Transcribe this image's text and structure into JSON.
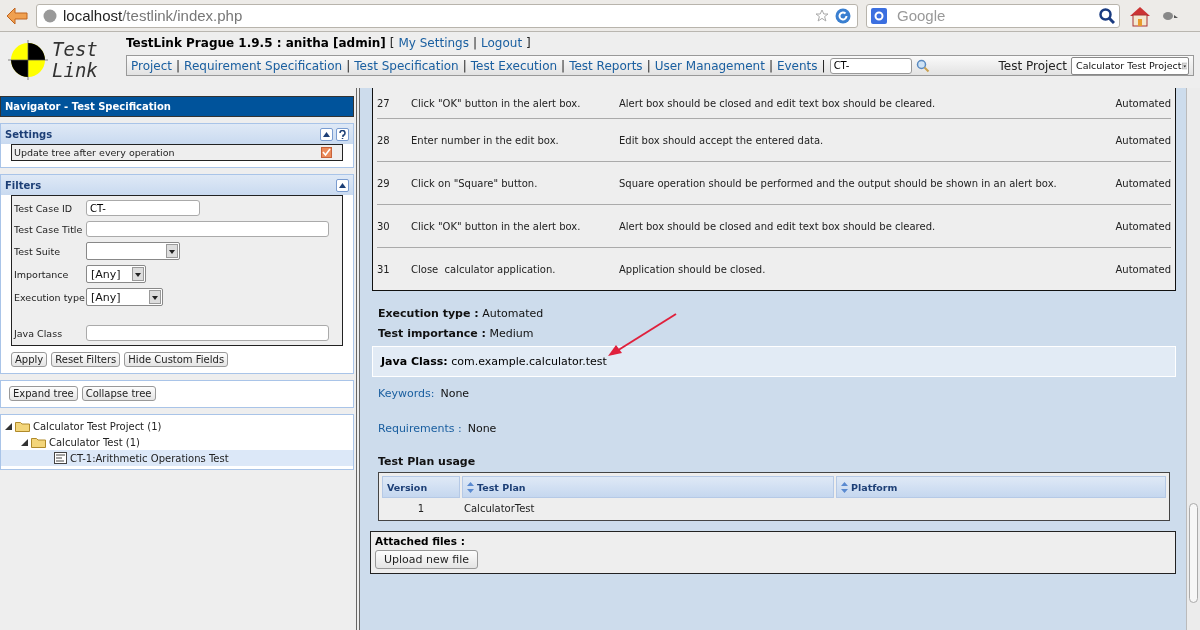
{
  "browser": {
    "url_host": "localhost",
    "url_path": "/testlink/index.php",
    "search_placeholder": "Google"
  },
  "header": {
    "logo": {
      "line_1": "Test",
      "line_2": "Link"
    },
    "title": "TestLink Prague 1.9.5 : anitha [admin]",
    "account": [
      {
        "kind": "separator",
        "text": "["
      },
      {
        "kind": "link",
        "text": "My Settings"
      },
      {
        "kind": "separator",
        "text": "|"
      },
      {
        "kind": "link",
        "text": "Logout"
      },
      {
        "kind": "separator",
        "text": "]"
      }
    ],
    "menu": [
      {
        "kind": "link",
        "text": "Project"
      },
      {
        "kind": "separator",
        "text": "|"
      },
      {
        "kind": "link",
        "text": "Requirement Specification"
      },
      {
        "kind": "separator",
        "text": "|"
      },
      {
        "kind": "link",
        "text": "Test Specification"
      },
      {
        "kind": "separator",
        "text": "|"
      },
      {
        "kind": "link",
        "text": "Test Execution"
      },
      {
        "kind": "separator",
        "text": "|"
      },
      {
        "kind": "link",
        "text": "Test Reports"
      },
      {
        "kind": "separator",
        "text": "|"
      },
      {
        "kind": "link",
        "text": "User Management"
      },
      {
        "kind": "separator",
        "text": "|"
      },
      {
        "kind": "link",
        "text": "Events"
      },
      {
        "kind": "separator",
        "text": "|"
      }
    ],
    "search_value": "CT-",
    "project_label": "Test Project",
    "project_value": "Calculator Test Project"
  },
  "navigator": {
    "title": "Navigator - Test Specification",
    "settings": {
      "title": "Settings",
      "option": {
        "label": "Update tree after every operation",
        "checked": true
      }
    },
    "filters": {
      "title": "Filters",
      "fields": [
        {
          "kind": "text",
          "label": "Test Case ID",
          "value": "CT-"
        },
        {
          "kind": "text",
          "label": "Test Case Title"
        },
        {
          "kind": "select",
          "label": "Test Suite"
        },
        {
          "kind": "select",
          "label": "Importance",
          "value": "[Any]"
        },
        {
          "kind": "select",
          "label": "Execution type",
          "value": "[Any]"
        },
        {
          "kind": "text",
          "label": "Java Class"
        }
      ],
      "buttons": [
        "Apply",
        "Reset Filters",
        "Hide Custom Fields"
      ]
    },
    "tree_buttons": [
      "Expand tree",
      "Collapse tree"
    ],
    "tree": [
      {
        "kind": "folder",
        "label": "Calculator Test Project (1)",
        "selected": false,
        "children": [
          {
            "kind": "folder",
            "label": "Calculator Test (1)",
            "selected": false,
            "children": [
              {
                "kind": "testcase",
                "label": "CT-1:Arithmetic Operations Test",
                "selected": true
              }
            ]
          }
        ]
      }
    ]
  },
  "steps": [
    {
      "number": "27",
      "action": "Click \"OK\" button in the alert box.",
      "expected": "Alert box should be closed and edit text box should be cleared.",
      "execution": "Automated"
    },
    {
      "number": "28",
      "action": "Enter number in the edit box.",
      "expected": "Edit box should accept the entered data.",
      "execution": "Automated"
    },
    {
      "number": "29",
      "action": "Click on \"Square\" button.",
      "expected": "Square operation should be performed and the output should be shown in an alert box.",
      "execution": "Automated"
    },
    {
      "number": "30",
      "action": "Click \"OK\" button in the alert box.",
      "expected": "Alert box should be closed and edit text box should be cleared.",
      "execution": "Automated"
    },
    {
      "number": "31",
      "action": "Close  calculator application.",
      "expected": "Application should be closed.",
      "execution": "Automated"
    }
  ],
  "details": [
    {
      "label": "Execution type :",
      "value": "Automated"
    },
    {
      "label": "Test importance :",
      "value": "Medium"
    }
  ],
  "custom_field": {
    "label": "Java Class:",
    "value": "com.example.calculator.test"
  },
  "keywords": {
    "label": "Keywords:",
    "value": "None"
  },
  "requirements": {
    "label": "Requirements :",
    "value": "None"
  },
  "plan_usage": {
    "title": "Test Plan usage",
    "columns": [
      {
        "label": "Version",
        "sortable": false
      },
      {
        "label": "Test Plan",
        "sortable": true
      },
      {
        "label": "Platform",
        "sortable": true
      }
    ],
    "rows": [
      [
        "1",
        "CalculatorTest",
        null
      ]
    ]
  },
  "attachments": {
    "title": "Attached files :",
    "button": "Upload new file"
  }
}
